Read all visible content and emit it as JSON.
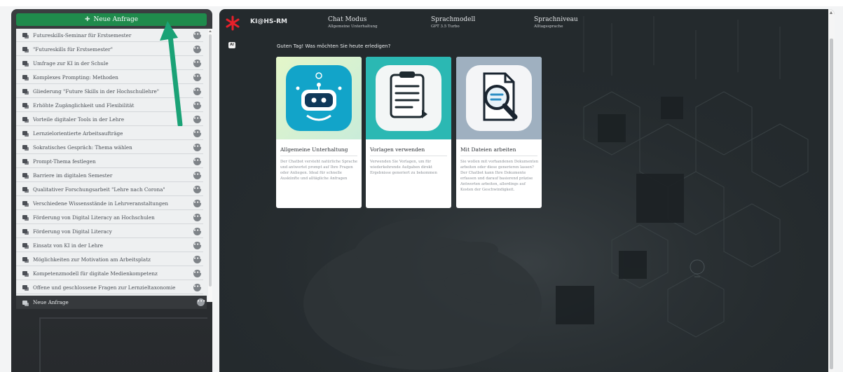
{
  "sidebar": {
    "new_request_label": "Neue Anfrage",
    "items": [
      {
        "label": "Futureskills-Seminar für Erstsemester"
      },
      {
        "label": "\"Futureskills für Erstsemester\""
      },
      {
        "label": "Umfrage zur KI in der Schule"
      },
      {
        "label": "Komplexes Prompting: Methoden"
      },
      {
        "label": "Gliederung \"Future Skills in der Hochschullehre\""
      },
      {
        "label": "Erhöhte Zugänglichkeit und Flexibilität"
      },
      {
        "label": "Vorteile digitaler Tools in der Lehre"
      },
      {
        "label": "Lernzielorientierte Arbeitsaufträge"
      },
      {
        "label": "Sokratisches Gespräch: Thema wählen"
      },
      {
        "label": "Prompt-Thema festlegen"
      },
      {
        "label": "Barriere im digitalen Semester"
      },
      {
        "label": "Qualitativer Forschungsarbeit \"Lehre nach Corona\""
      },
      {
        "label": "Verschiedene Wissensstände in Lehrveranstaltungen"
      },
      {
        "label": "Förderung von Digital Literacy an Hochschulen"
      },
      {
        "label": "Förderung von Digital Literacy"
      },
      {
        "label": "Einsatz von KI in der Lehre"
      },
      {
        "label": "Möglichkeiten zur Motivation am Arbeitsplatz"
      },
      {
        "label": "Kompetenzmodell für digitale Medienkompetenz"
      },
      {
        "label": "Offene und geschlossene Fragen zur Lernzieltaxonomie"
      }
    ],
    "active_item": {
      "label": "Neue Anfrage"
    },
    "more_glyph": "•••"
  },
  "header": {
    "brand": "KI@HS-RM",
    "chat_mode": {
      "title": "Chat Modus",
      "value": "Allgemeine Unterhaltung"
    },
    "language_model": {
      "title": "Sprachmodell",
      "value": "GPT 3.5 Turbo"
    },
    "language_level": {
      "title": "Sprachniveau",
      "value": "Alltagssprache"
    }
  },
  "main": {
    "ai_badge": "AI",
    "greeting": "Guten Tag! Was möchten Sie heute erledigen?",
    "cards": [
      {
        "title": "Allgemeine Unterhaltung",
        "description": "Der Chatbot versteht natürliche Sprache und antwortet prompt auf Ihre Fragen oder Anliegen. Ideal für schnelle Auskünfte und alltägliche Anfragen",
        "icon": "robot-icon"
      },
      {
        "title": "Vorlagen verwenden",
        "description": "Verwenden Sie Vorlagen, um für wiederkehrende Aufgaben direkt Ergebnisse generiert zu bekommen",
        "icon": "clipboard-icon"
      },
      {
        "title": "Mit Dateien arbeiten",
        "description": "Sie wollen mit vorhandenen Dokumenten arbeiten oder diese generieren lassen? Der Chatbot kann Ihre Dokumente erfassen und darauf basierend präzise Antworten arbeiten, allerdings auf Kosten der Geschwindigkeit.",
        "icon": "document-search-icon"
      }
    ]
  },
  "colors": {
    "accent_green": "#1f8b4c",
    "arrow_green": "#1aa276",
    "logo_red": "#e8202a",
    "main_bg": "#242a2d"
  }
}
